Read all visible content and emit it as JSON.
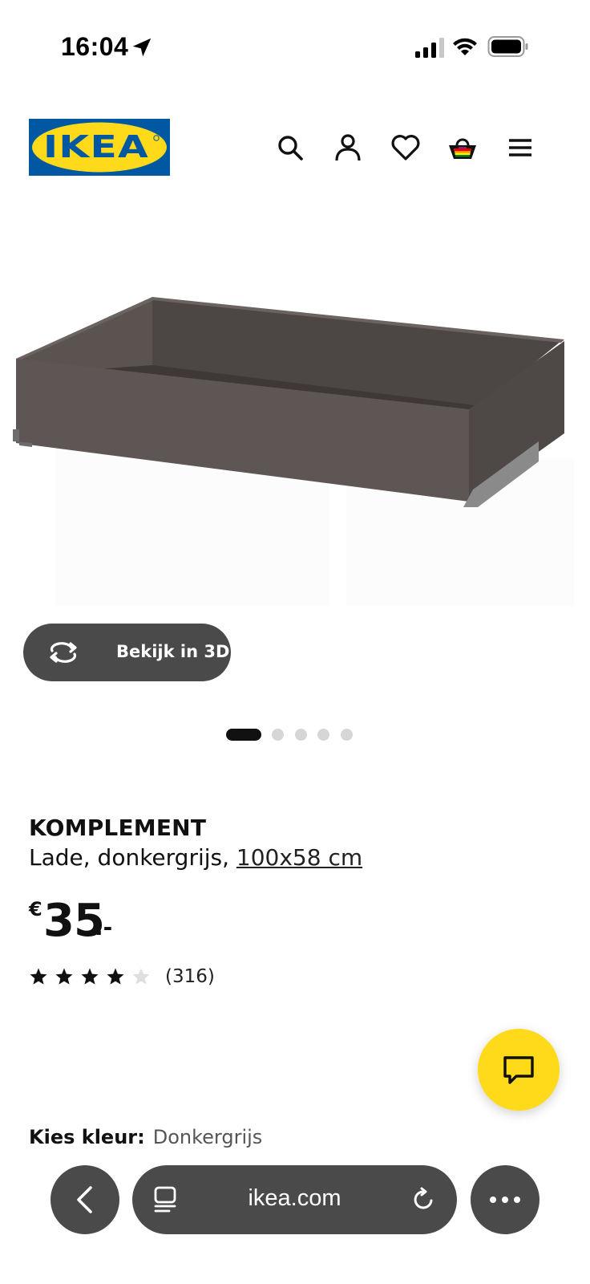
{
  "status_bar": {
    "time": "16:04",
    "icons": [
      "location-arrow-icon",
      "cellular-signal-icon",
      "wifi-icon",
      "battery-icon"
    ]
  },
  "header": {
    "logo_text": "IKEA",
    "brand_colors": {
      "blue": "#0058a3",
      "yellow": "#ffda1a"
    },
    "nav_icons": [
      "search-icon",
      "user-icon",
      "heart-icon",
      "shopping-basket-icon",
      "menu-icon"
    ]
  },
  "product_image": {
    "alt_icon": "drawer-image",
    "view_3d_label": "Bekijk in 3D",
    "carousel": {
      "total": 5,
      "active_index": 0
    }
  },
  "product": {
    "name": "KOMPLEMENT",
    "description": "Lade, donkergrijs, ",
    "size": "100x58 cm",
    "price": {
      "currency": "€",
      "integer": "35",
      "decimal": ".-"
    },
    "rating": {
      "stars": 4,
      "max": 5,
      "review_count": "(316)"
    },
    "colour_label": "Kies kleur:",
    "colour_value": "Donkergrijs"
  },
  "chat": {
    "icon": "chat-bubble-icon",
    "color": "#ffda1a"
  },
  "browser": {
    "url": "ikea.com",
    "icons": [
      "back-icon",
      "reader-icon",
      "reload-icon",
      "more-icon"
    ],
    "control_color": "#4a4a4a"
  }
}
